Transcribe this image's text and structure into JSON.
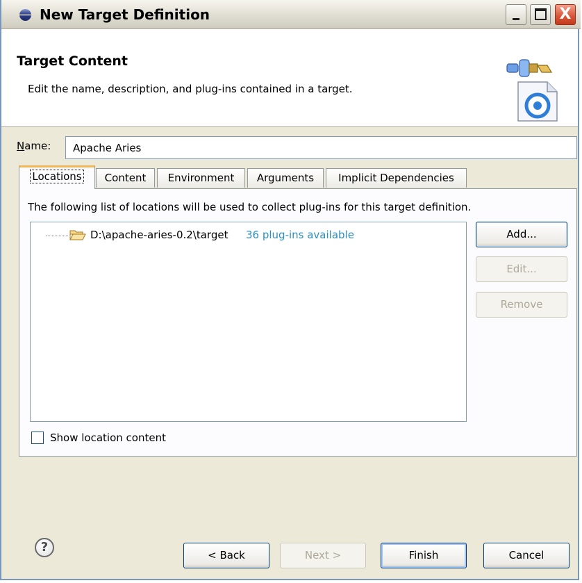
{
  "window": {
    "title": "New Target Definition",
    "controls": {
      "minimize": "minimize-icon",
      "maximize": "maximize-icon",
      "close": "close-icon",
      "close_glyph": "X"
    }
  },
  "header": {
    "title": "Target Content",
    "description": "Edit the name, description, and plug-ins contained in a target.",
    "icon": "target-definition-wizard-icon"
  },
  "name_field": {
    "label": "Name:",
    "value": "Apache Aries"
  },
  "tabs": [
    {
      "label": "Locations",
      "active": true
    },
    {
      "label": "Content",
      "active": false
    },
    {
      "label": "Environment",
      "active": false
    },
    {
      "label": "Arguments",
      "active": false
    },
    {
      "label": "Implicit Dependencies",
      "active": false
    }
  ],
  "locations_panel": {
    "description": "The following list of locations will be used to collect plug-ins for this target definition.",
    "items": [
      {
        "icon": "folder-open-icon",
        "path": "D:\\apache-aries-0.2\\target",
        "status": "36 plug-ins available"
      }
    ],
    "buttons": {
      "add": "Add...",
      "edit": "Edit...",
      "remove": "Remove"
    },
    "show_content": {
      "label": "Show location content",
      "checked": false
    }
  },
  "footer": {
    "help_icon": "help-icon",
    "help_glyph": "?",
    "buttons": {
      "back": "< Back",
      "next": "Next >",
      "finish": "Finish",
      "cancel": "Cancel"
    }
  },
  "colors": {
    "status_text": "#2d8fbf",
    "active_tab_accent": "#f1b75b",
    "window_frame": "#7a96b8"
  }
}
